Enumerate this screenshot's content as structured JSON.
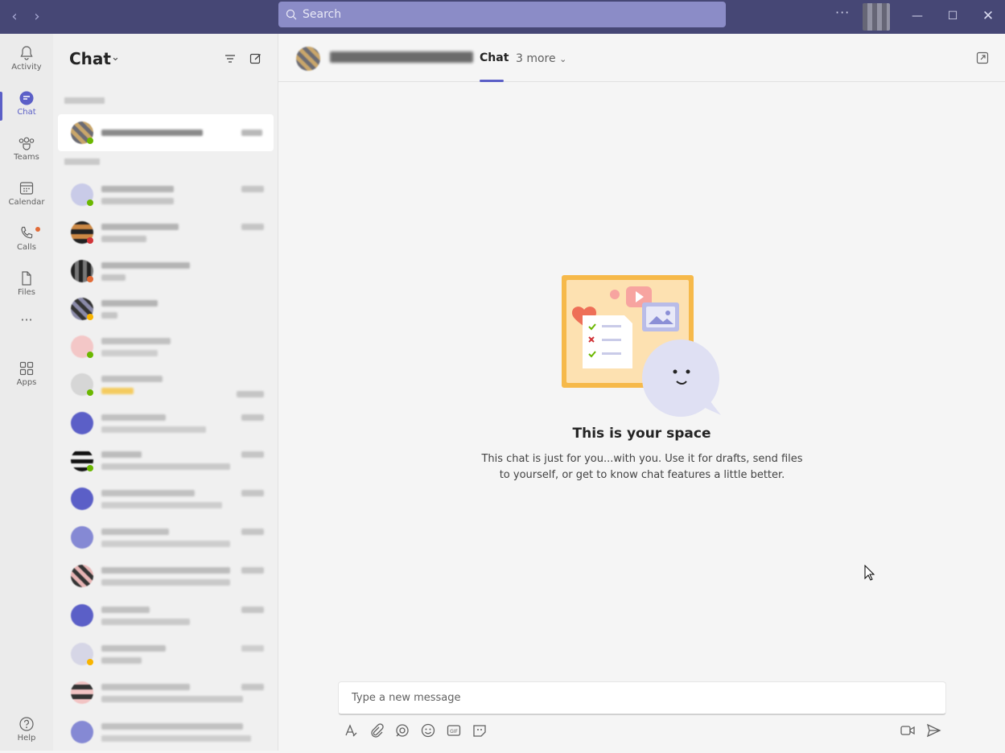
{
  "titlebar": {
    "search_placeholder": "Search",
    "back_icon": "chevron-left-icon",
    "forward_icon": "chevron-right-icon",
    "more_label": "···"
  },
  "rail": {
    "items": [
      {
        "label": "Activity",
        "icon": "bell-icon"
      },
      {
        "label": "Chat",
        "icon": "chat-icon",
        "active": true
      },
      {
        "label": "Teams",
        "icon": "teams-icon"
      },
      {
        "label": "Calendar",
        "icon": "calendar-icon"
      },
      {
        "label": "Calls",
        "icon": "phone-icon"
      },
      {
        "label": "Files",
        "icon": "file-icon"
      },
      {
        "label": "Apps",
        "icon": "apps-icon"
      },
      {
        "label": "Help",
        "icon": "help-icon"
      }
    ],
    "more_label": "···"
  },
  "chat_list": {
    "title": "Chat"
  },
  "conversation": {
    "tab_chat": "Chat",
    "tab_more": "3 more"
  },
  "welcome": {
    "title": "This is your space",
    "body": "This chat is just for you...with you. Use it for drafts, send files to yourself, or get to know chat features a little better."
  },
  "composer": {
    "placeholder": "Type a new message"
  },
  "colors": {
    "titlebar": "#464775",
    "accent": "#5b5fc7",
    "notification": "#e26b37"
  }
}
